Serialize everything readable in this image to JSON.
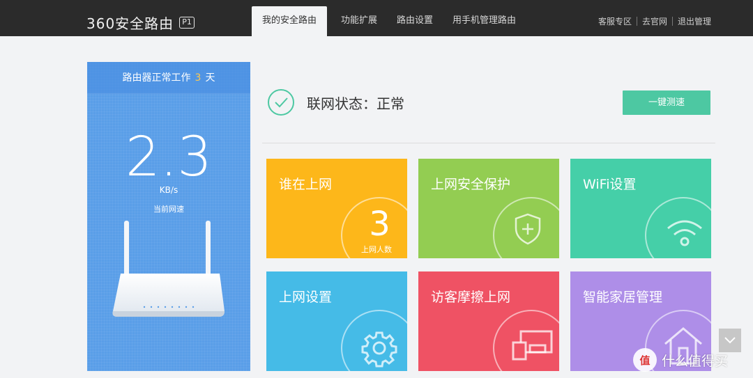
{
  "header": {
    "logo_text": "360安全路由",
    "logo_badge": "P1",
    "tabs": [
      {
        "label": "我的安全路由",
        "active": true
      },
      {
        "label": "功能扩展",
        "active": false
      },
      {
        "label": "路由设置",
        "active": false
      },
      {
        "label": "用手机管理路由",
        "active": false
      }
    ],
    "links": [
      "客服专区",
      "去官网",
      "退出管理"
    ]
  },
  "left_panel": {
    "uptime_prefix": "路由器正常工作",
    "uptime_days": "3",
    "uptime_suffix": "天",
    "speed_value": "2.3",
    "speed_unit": "KB/s",
    "speed_label": "当前网速"
  },
  "status": {
    "text": "联网状态：正常",
    "icon": "check-circle-icon",
    "speedtest_button": "一键测速"
  },
  "tiles": [
    {
      "title": "谁在上网",
      "count": "3",
      "count_label": "上网人数",
      "color": "#fdb71a"
    },
    {
      "title": "上网安全保护",
      "icon": "shield-plus-icon",
      "color": "#93cd52"
    },
    {
      "title": "WiFi设置",
      "icon": "wifi-icon",
      "color": "#45cfa8"
    },
    {
      "title": "上网设置",
      "icon": "gear-icon",
      "color": "#45bbe7"
    },
    {
      "title": "访客摩擦上网",
      "icon": "devices-icon",
      "color": "#ef5264"
    },
    {
      "title": "智能家居管理",
      "icon": "home-icon",
      "color": "#ae8ee8"
    }
  ],
  "overlay": {
    "scroll_icon": "chevron-down-icon",
    "watermark_badge": "值",
    "watermark_text": "什么值得买"
  }
}
